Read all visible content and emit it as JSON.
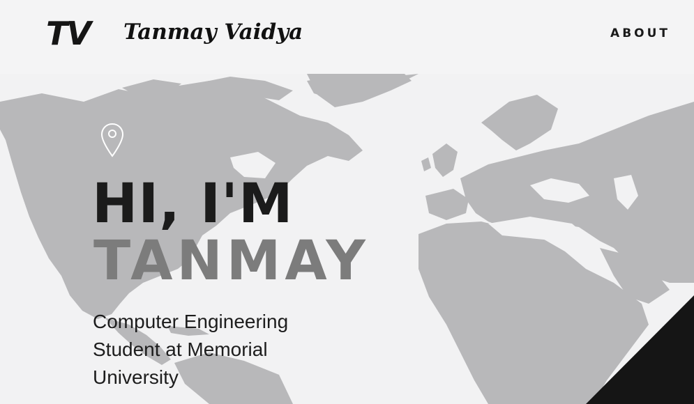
{
  "header": {
    "logo": "TV",
    "site_name": "Tanmay Vaidya",
    "nav": {
      "about_label": "ABOUT"
    }
  },
  "hero": {
    "greeting": "HI, I'M",
    "name": "TANMAY",
    "tagline": "Computer Engineering Student at Memorial University",
    "icon": "location-pin-icon"
  },
  "colors": {
    "background": "#f3f3f4",
    "map_land": "#b9b9bb",
    "greeting_text": "#1b1b1b",
    "name_text": "#7c7c7c",
    "corner_accent": "#151515"
  }
}
